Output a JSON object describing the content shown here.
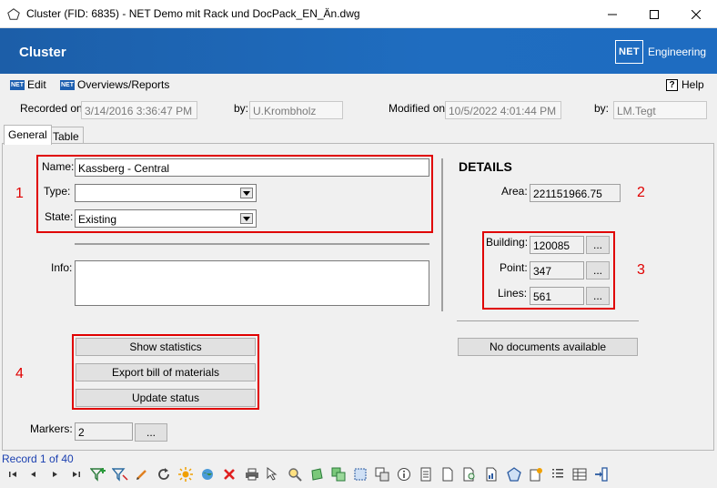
{
  "window": {
    "title": "Cluster (FID: 6835) - NET Demo mit Rack und DocPack_EN_Än.dwg"
  },
  "header": {
    "title": "Cluster",
    "logo_box": "NET",
    "logo_text": "Engineering"
  },
  "menu": {
    "edit": "Edit",
    "overviews": "Overviews/Reports",
    "help": "Help"
  },
  "meta": {
    "recorded_label": "Recorded on:",
    "recorded_value": "3/14/2016 3:36:47 PM",
    "by1_label": "by:",
    "by1_value": "U.Krombholz",
    "modified_label": "Modified on:",
    "modified_value": "10/5/2022 4:01:44 PM",
    "by2_label": "by:",
    "by2_value": "LM.Tegt"
  },
  "tabs": [
    "General",
    "Table"
  ],
  "form": {
    "name_label": "Name:",
    "name_value": "Kassberg - Central",
    "type_label": "Type:",
    "type_value": "",
    "state_label": "State:",
    "state_value": "Existing",
    "info_label": "Info:",
    "info_value": "",
    "markers_label": "Markers:",
    "markers_value": "2",
    "ellipsis": "..."
  },
  "buttons": {
    "show_statistics": "Show statistics",
    "export_bom": "Export bill of materials",
    "update_status": "Update status"
  },
  "details": {
    "heading": "DETAILS",
    "area_label": "Area:",
    "area_value": "221151966.75",
    "building_label": "Building:",
    "building_value": "120085",
    "point_label": "Point:",
    "point_value": "347",
    "lines_label": "Lines:",
    "lines_value": "561",
    "no_docs": "No documents available"
  },
  "annotations": [
    "1",
    "2",
    "3",
    "4"
  ],
  "status": {
    "record": "Record 1 of 40"
  },
  "colors": {
    "header_blue": "#1f6dc0",
    "annotation_red": "#e00000",
    "record_blue": "#1a3fb0"
  }
}
